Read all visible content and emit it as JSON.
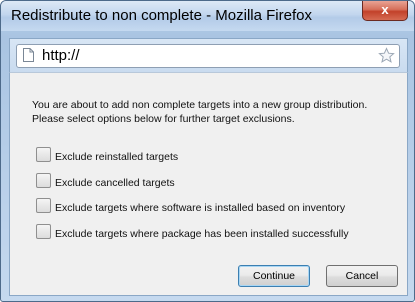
{
  "window": {
    "title": "Redistribute to non complete - Mozilla Firefox",
    "close_label": "x"
  },
  "urlbar": {
    "url": "http://"
  },
  "dialog": {
    "message_line1": "You are about to add non complete targets into a new group distribution.",
    "message_line2": "Please select options below for further target exclusions.",
    "options": [
      {
        "label": "Exclude reinstalled targets",
        "checked": false
      },
      {
        "label": "Exclude cancelled targets",
        "checked": false
      },
      {
        "label": "Exclude targets where software is installed based on inventory",
        "checked": false
      },
      {
        "label": "Exclude targets where package has been installed successfully",
        "checked": false
      }
    ],
    "continue_label": "Continue",
    "cancel_label": "Cancel"
  },
  "colors": {
    "frame": "#b9d1ea",
    "content_bg": "#f0f0f0",
    "close_button": "#c2412a",
    "primary_border": "#3c7fb1"
  }
}
